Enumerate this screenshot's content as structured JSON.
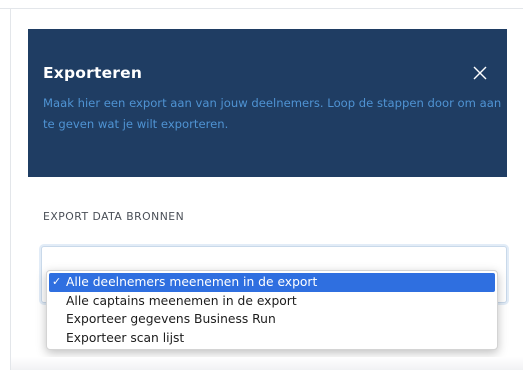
{
  "modal": {
    "title": "Exporteren",
    "description": "Maak hier een export aan van jouw deelnemers. Loop de stappen door om aan te geven wat je wilt exporteren.",
    "close_icon": "close-icon"
  },
  "export": {
    "section_label": "EXPORT DATA BRONNEN",
    "select": {
      "selected_value": "Alle deelnemers meenemen in de export",
      "options": [
        {
          "label": "Alle deelnemers meenemen in de export",
          "selected": true,
          "check": "✓"
        },
        {
          "label": "Alle captains meenemen in de export",
          "selected": false
        },
        {
          "label": "Exporteer gegevens Business Run",
          "selected": false
        },
        {
          "label": "Exporteer scan lijst",
          "selected": false
        }
      ]
    }
  },
  "colors": {
    "header_bg": "#1f3d63",
    "description_text": "#4f93d3",
    "highlight": "#2f6fe0"
  }
}
